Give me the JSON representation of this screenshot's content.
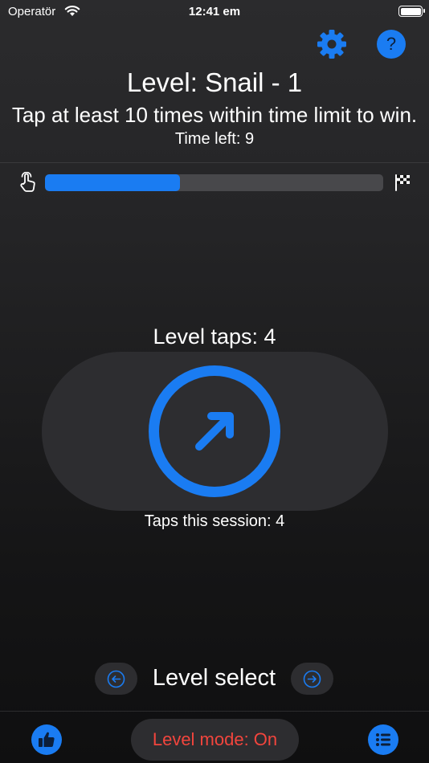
{
  "status_bar": {
    "carrier": "Operatör",
    "time": "12:41 em"
  },
  "header": {
    "settings_icon": "gear-icon",
    "help_icon": "question-icon",
    "help_label": "?",
    "title": "Level: Snail - 1",
    "instruction": "Tap at least 10 times within time limit to win.",
    "time_left": "Time left: 9"
  },
  "progress": {
    "start_icon": "tap-hand-icon",
    "end_icon": "checkered-flag-icon",
    "fraction": 0.4
  },
  "tap_area": {
    "level_taps": "Level taps: 4",
    "session_taps": "Taps this session: 4",
    "icon": "arrow-up-right-icon"
  },
  "level_nav": {
    "prev_icon": "arrow-left-circle-icon",
    "label": "Level select",
    "next_icon": "arrow-right-circle-icon"
  },
  "footer": {
    "like_icon": "thumbs-up-icon",
    "mode_label": "Level mode: On",
    "list_icon": "list-icon"
  },
  "colors": {
    "accent": "#1a7cf2",
    "mode_text": "#f2453d",
    "pill_bg": "#2d2d30"
  }
}
